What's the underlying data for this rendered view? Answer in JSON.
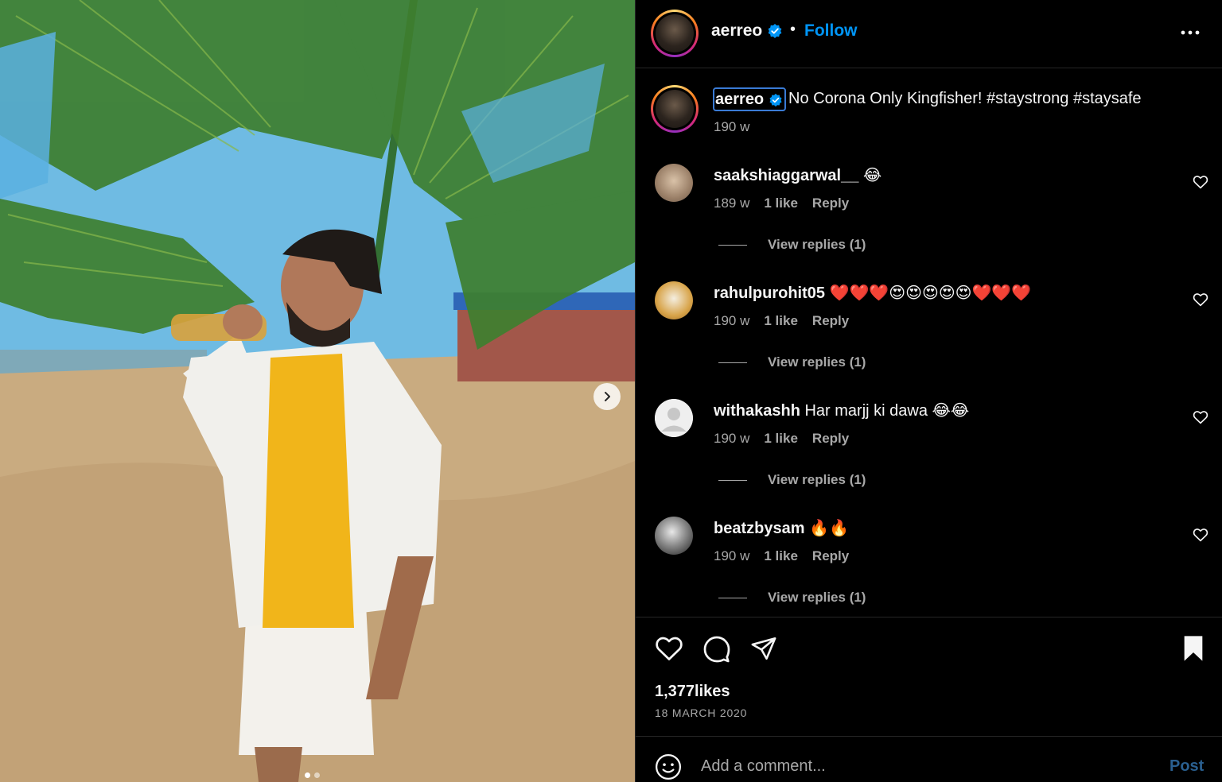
{
  "post": {
    "author": "aerreo",
    "verified": true,
    "follow_label": "Follow",
    "separator": "•",
    "more_icon": "more-options-icon",
    "caption": "No Corona Only Kingfisher! #staystrong #staysafe",
    "caption_time": "190 w",
    "likes": "1,377likes",
    "date": "18 MARCH 2020",
    "carousel": {
      "slides": 2,
      "current": 1
    }
  },
  "comments": [
    {
      "user": "saakshiaggarwal__",
      "text": "😂",
      "time": "189 w",
      "likes": "1 like",
      "reply_label": "Reply",
      "replies_label": "View replies (1)"
    },
    {
      "user": "rahulpurohit05",
      "text": "❤️❤️❤️😍😍😍😍😍❤️❤️❤️",
      "time": "190 w",
      "likes": "1 like",
      "reply_label": "Reply",
      "replies_label": "View replies (1)"
    },
    {
      "user": "withakashh",
      "text": "Har marjj ki dawa 😂😂",
      "time": "190 w",
      "likes": "1 like",
      "reply_label": "Reply",
      "replies_label": "View replies (1)"
    },
    {
      "user": "beatzbysam",
      "text": "🔥🔥",
      "time": "190 w",
      "likes": "1 like",
      "reply_label": "Reply",
      "replies_label": "View replies (1)"
    }
  ],
  "composer": {
    "placeholder": "Add a comment...",
    "post_label": "Post"
  },
  "colors": {
    "accent": "#0095f6",
    "background": "#000000",
    "muted_text": "#a8a8a8",
    "post_disabled": "#2a5f8f"
  }
}
